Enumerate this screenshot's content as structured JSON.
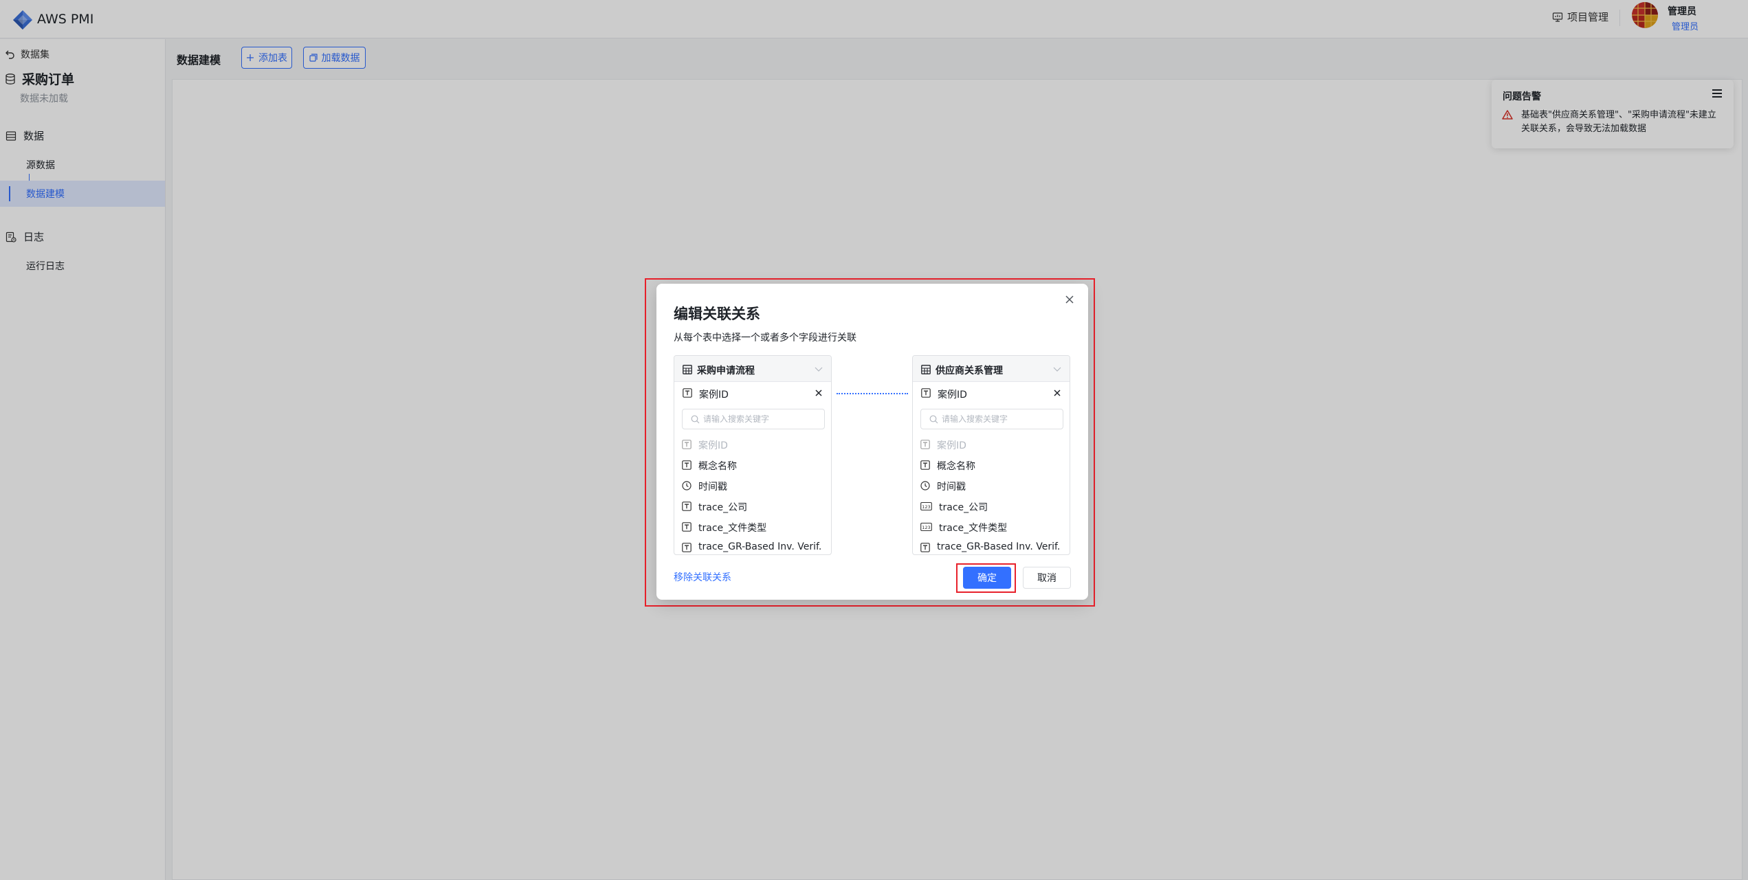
{
  "app": {
    "title": "AWS PMI"
  },
  "topbar": {
    "project_manage": "项目管理",
    "user_name": "管理员",
    "user_role": "管理员"
  },
  "sidebar": {
    "back_label": "数据集",
    "dataset_title": "采购订单",
    "dataset_status": "数据未加载",
    "groups": [
      {
        "label": "数据",
        "items": [
          "源数据",
          "数据建模"
        ]
      },
      {
        "label": "日志",
        "items": [
          "运行日志"
        ]
      }
    ]
  },
  "main": {
    "title": "数据建模",
    "add_table": "添加表",
    "load_data": "加载数据"
  },
  "alert": {
    "title": "问题告警",
    "message": "基础表\"供应商关系管理\"、\"采购申请流程\"未建立关联关系，会导致无法加载数据"
  },
  "modal": {
    "title": "编辑关联关系",
    "description": "从每个表中选择一个或者多个字段进行关联",
    "left": {
      "table_name": "采购申请流程",
      "selected_field": "案例ID",
      "search_placeholder": "请输入搜索关键字",
      "fields": [
        "案例ID",
        "概念名称",
        "时间戳",
        "trace_公司",
        "trace_文件类型",
        "trace_GR-Based Inv. Verif."
      ]
    },
    "right": {
      "table_name": "供应商关系管理",
      "selected_field": "案例ID",
      "search_placeholder": "请输入搜索关键字",
      "fields": [
        "案例ID",
        "概念名称",
        "时间戳",
        "trace_公司",
        "trace_文件类型",
        "trace_GR-Based Inv. Verif."
      ]
    },
    "remove_link": "移除关联关系",
    "confirm": "确定",
    "cancel": "取消"
  },
  "colors": {
    "accent": "#3370ff",
    "highlight": "#e8212b",
    "warning": "#d93026"
  },
  "icons": {
    "left_fields": [
      "text-icon",
      "text-icon",
      "clock-icon",
      "text-icon",
      "text-icon",
      "text-icon"
    ],
    "right_fields": [
      "text-icon",
      "text-icon",
      "clock-icon",
      "number-icon",
      "number-icon",
      "text-icon"
    ]
  }
}
